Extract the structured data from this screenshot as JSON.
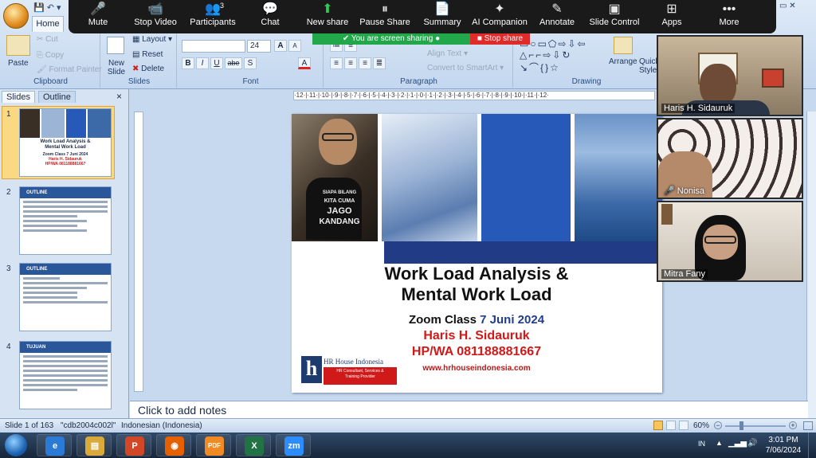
{
  "qat": "💾 ↶ ▾",
  "ribbon": {
    "home_tab": "Home",
    "clipboard": {
      "paste": "Paste",
      "cut": "Cut",
      "copy": "Copy",
      "format_painter": "Format Painter",
      "label": "Clipboard"
    },
    "slides": {
      "new_slide": "New Slide",
      "layout": "Layout ▾",
      "reset": "Reset",
      "delete": "Delete",
      "label": "Slides"
    },
    "font": {
      "size": "24",
      "label": "Font",
      "bold": "B",
      "italic": "I",
      "underline": "U",
      "strike": "abe",
      "shadow": "S",
      "grow": "A",
      "shrink": "A"
    },
    "paragraph": {
      "align_text": "Align Text ▾",
      "convert_smartart": "Convert to SmartArt ▾",
      "label": "Paragraph"
    },
    "drawing": {
      "arrange": "Arrange",
      "quick_styles": "Quick Styles",
      "label": "Drawing"
    }
  },
  "zoom": {
    "items": [
      {
        "label": "Mute",
        "icon": "🎤"
      },
      {
        "label": "Stop Video",
        "icon": "📹"
      },
      {
        "label": "Participants",
        "icon": "👥",
        "count": "3"
      },
      {
        "label": "Chat",
        "icon": "💬"
      },
      {
        "label": "New share",
        "icon": "⬆"
      },
      {
        "label": "Pause Share",
        "icon": "⏸"
      },
      {
        "label": "Summary",
        "icon": "📄"
      },
      {
        "label": "AI Companion",
        "icon": "✦"
      },
      {
        "label": "Annotate",
        "icon": "✎"
      },
      {
        "label": "Slide Control",
        "icon": "▣"
      },
      {
        "label": "Apps",
        "icon": "⊞"
      },
      {
        "label": "More",
        "icon": "•••"
      }
    ],
    "sharing_banner": "You are screen sharing",
    "stop_share": "Stop share"
  },
  "panel": {
    "tab_slides": "Slides",
    "tab_outline": "Outline",
    "close": "×"
  },
  "thumbnails": [
    {
      "num": "1",
      "line1": "Work Load Analysis &",
      "line2": "Mental Work Load",
      "line3": "Zoom Class 7 Juni 2024",
      "line4": "Haris H. Sidauruk",
      "line5": "HP/WA 081188881667"
    },
    {
      "num": "2",
      "head": "OUTLINE"
    },
    {
      "num": "3",
      "head": "OUTLINE"
    },
    {
      "num": "4",
      "head": "TUJUAN"
    }
  ],
  "ruler": "·12·|·11·|·10·|·9·|·8·|·7·|·6·|·5·|·4·|·3·|·2·|·1·|·0·|·1·|·2·|·3·|·4·|·5·|·6·|·7·|·8·|·9·|·10·|·11·|·12·",
  "slide": {
    "photo_text1": "SIAPA BILANG",
    "photo_text2": "KITA CUMA",
    "photo_text3": "JAGO",
    "photo_text4": "KANDANG",
    "title_line1": "Work Load Analysis &",
    "title_line2": "Mental Work Load",
    "zoom_class": "Zoom Class",
    "date": "7 Juni 2024",
    "presenter": "Haris H. Sidauruk",
    "phone": "HP/WA 081188881667",
    "website": "www.hrhouseindonesia.com",
    "logo_letter": "h",
    "logo_name": "HR House Indonesia",
    "logo_tag1": "HR Consultant, Services &",
    "logo_tag2": "Training Provider"
  },
  "notes_placeholder": "Click to add notes",
  "status": {
    "slide_info": "Slide 1 of 163",
    "theme": "\"cdb2004c002l\"",
    "language": "Indonesian (Indonesia)",
    "zoom": "60%"
  },
  "participants": [
    {
      "name": "Haris H. Sidauruk"
    },
    {
      "name": "Nonisa",
      "muted_icon": "🎤"
    },
    {
      "name": "Mitra Fany"
    }
  ],
  "taskbar": {
    "apps": [
      {
        "name": "Internet Explorer",
        "icon": "e",
        "color": "#2a7ad6"
      },
      {
        "name": "File Explorer",
        "icon": "▤",
        "color": "#d9a93a"
      },
      {
        "name": "PowerPoint",
        "icon": "P",
        "color": "#d24726"
      },
      {
        "name": "Firefox",
        "icon": "◉",
        "color": "#e66000"
      },
      {
        "name": "PDF",
        "icon": "PDF",
        "color": "#f08a24"
      },
      {
        "name": "Excel",
        "icon": "X",
        "color": "#217346"
      },
      {
        "name": "Zoom",
        "icon": "zm",
        "color": "#2d8cff"
      }
    ],
    "lang": "IN",
    "time": "3:01 PM",
    "date": "7/06/2024"
  }
}
